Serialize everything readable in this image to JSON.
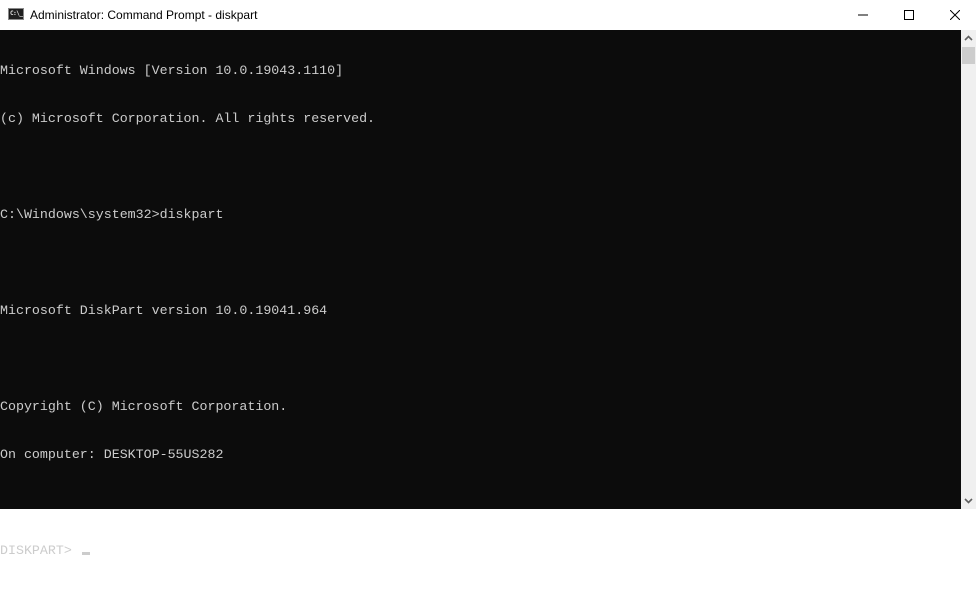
{
  "window": {
    "title": "Administrator: Command Prompt - diskpart",
    "icon_text": "C:\\_",
    "controls": {
      "minimize": "minimize-icon",
      "maximize": "maximize-icon",
      "close": "close-icon"
    }
  },
  "console": {
    "lines": [
      "Microsoft Windows [Version 10.0.19043.1110]",
      "(c) Microsoft Corporation. All rights reserved.",
      "",
      "C:\\Windows\\system32>diskpart",
      "",
      "Microsoft DiskPart version 10.0.19041.964",
      "",
      "Copyright (C) Microsoft Corporation.",
      "On computer: DESKTOP-55US282",
      "",
      "DISKPART> "
    ],
    "prompt": "DISKPART> ",
    "input_value": "",
    "colors": {
      "background": "#0c0c0c",
      "foreground": "#cccccc"
    }
  },
  "scrollbar": {
    "up_icon": "chevron-up-icon",
    "down_icon": "chevron-down-icon"
  }
}
